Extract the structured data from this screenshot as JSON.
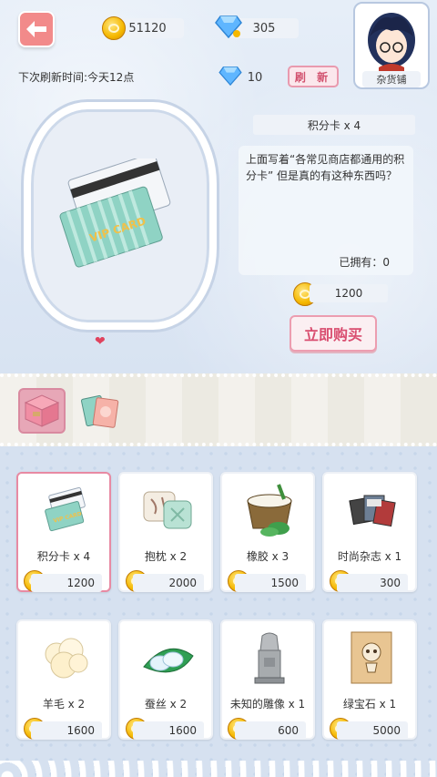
{
  "header": {
    "coins": "51120",
    "gems": "305",
    "shop_name": "杂货铺"
  },
  "refresh": {
    "next_time": "下次刷新时间:今天12点",
    "cost": "10",
    "button_label": "刷 新"
  },
  "selected_item": {
    "title": "积分卡 x 4",
    "description": "上面写着“各常见商店都通用的积分卡” 但是真的有这种东西吗？",
    "owned": "已拥有：0",
    "price": "1200",
    "buy_label": "立即购买"
  },
  "categories": [
    {
      "icon": "gift-box-icon",
      "active": true
    },
    {
      "icon": "cards-icon",
      "active": false
    }
  ],
  "items": [
    {
      "name": "积分卡 x 4",
      "price": "1200",
      "icon": "vip-card-icon",
      "selected": true
    },
    {
      "name": "抱枕 x 2",
      "price": "2000",
      "icon": "pillow-icon",
      "selected": false
    },
    {
      "name": "橡胶 x 3",
      "price": "1500",
      "icon": "rubber-bucket-icon",
      "selected": false
    },
    {
      "name": "时尚杂志 x 1",
      "price": "300",
      "icon": "magazine-icon",
      "selected": false
    },
    {
      "name": "羊毛 x 2",
      "price": "1600",
      "icon": "wool-icon",
      "selected": false
    },
    {
      "name": "蚕丝 x 2",
      "price": "1600",
      "icon": "silk-icon",
      "selected": false
    },
    {
      "name": "未知的雕像 x 1",
      "price": "600",
      "icon": "statue-icon",
      "selected": false
    },
    {
      "name": "绿宝石 x 1",
      "price": "5000",
      "icon": "old-scroll-icon",
      "selected": false
    }
  ],
  "colors": {
    "accent_pink": "#e88aa3",
    "back_button": "#f28a8a",
    "coin_gold": "#f5b800",
    "gem_blue": "#5fb6ff"
  }
}
